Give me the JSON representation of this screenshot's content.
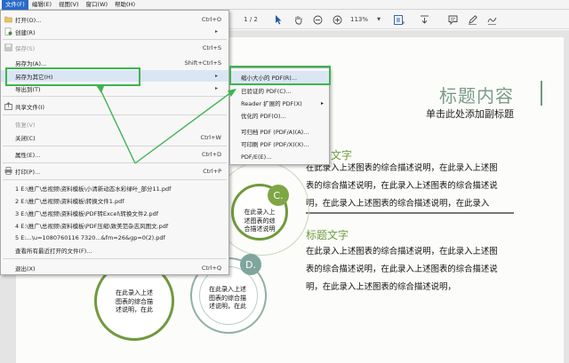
{
  "menubar": {
    "items": [
      "文件(F)",
      "编辑(E)",
      "视图(V)",
      "窗口(W)",
      "帮助(H)"
    ]
  },
  "toolbar": {
    "page_info": "1 / 2",
    "zoom": "113%"
  },
  "file_menu": {
    "open": {
      "label": "打开(O)...",
      "shortcut": "Ctrl+O"
    },
    "create": {
      "label": "创建(R)"
    },
    "save": {
      "label": "保存(S)",
      "shortcut": "Ctrl+S"
    },
    "save_as": {
      "label": "另存为(A)...",
      "shortcut": "Shift+Ctrl+S"
    },
    "save_as_other": {
      "label": "另存为其它(H)"
    },
    "export": {
      "label": "导出到(T)"
    },
    "share": {
      "label": "共享文件(I)"
    },
    "revert": {
      "label": "恢复(V)"
    },
    "close": {
      "label": "关闭(C)",
      "shortcut": "Ctrl+W"
    },
    "properties": {
      "label": "属性(E)...",
      "shortcut": "Ctrl+D"
    },
    "print": {
      "label": "打印(P)...",
      "shortcut": "Ctrl+P"
    },
    "recent": [
      "1 E:\\推广\\总视频\\资料模板\\小清新动态水彩绿叶_部分11.pdf",
      "2 E:\\推广\\总视频\\资料模板\\转换文件1.pdf",
      "3 E:\\推广\\总视频\\资料模板\\PDF转Excel\\转换文件2.pdf",
      "4 E:\\推广\\总视频\\资料模板\\PDF压缩\\致美范杂志风图文.pdf",
      "5 E:...\\u=1080760116 7320...&fm=26&gp=0(2).pdf"
    ],
    "view_all_recent": {
      "label": "查看所有最近打开的文件(F)..."
    },
    "exit": {
      "label": "退出(X)",
      "shortcut": "Ctrl+Q"
    }
  },
  "submenu": {
    "items": [
      {
        "label": "缩小大小的 PDF(R)..."
      },
      {
        "label": "已验证的 PDF(C)..."
      },
      {
        "label": "Reader 扩展的 PDF(X)"
      },
      {
        "label": "优化的 PDF(O)..."
      },
      {
        "label": "可归档 PDF (PDF/A)(A)..."
      },
      {
        "label": "可印刷 PDF (PDF/X)(X)..."
      },
      {
        "label": "PDF/E(E)..."
      }
    ]
  },
  "slide": {
    "title": "标题内容",
    "subtitle": "单击此处添加副标题",
    "section1_title": "文字",
    "section1_lines": [
      "在此录入上述图表的综合描述说明，在此录入上述图",
      "表的综合描述说明，在此录入上述图表的综合描述说",
      "明，在此录入上述图表的综合描述说明，在此录入"
    ],
    "section2_title": "标题文字",
    "section2_lines": [
      "在此录入上述图表的综合描述说明，在此录入上述图",
      "表的综合描述说明，在此录入上述图表的综合描述说",
      "明，在此录入上述图表的综合描述说明，"
    ],
    "circle_c_label": "C.",
    "circle_d_label": "D.",
    "circle_c_text": [
      "在此录入上",
      "述图表的综",
      "合描述说明"
    ],
    "circle_left_text": [
      "在此录入上述",
      "图表的综合描",
      "述说明，在此"
    ],
    "circle_mid_text": [
      "在此录入上述",
      "图表的综合描",
      "述说明，在此"
    ]
  },
  "colors": {
    "menu_active": "#2a6bc8",
    "highlight_box": "#3fb34f",
    "accent_green": "#6f9a3c",
    "accent_teal": "#7a9c88"
  }
}
